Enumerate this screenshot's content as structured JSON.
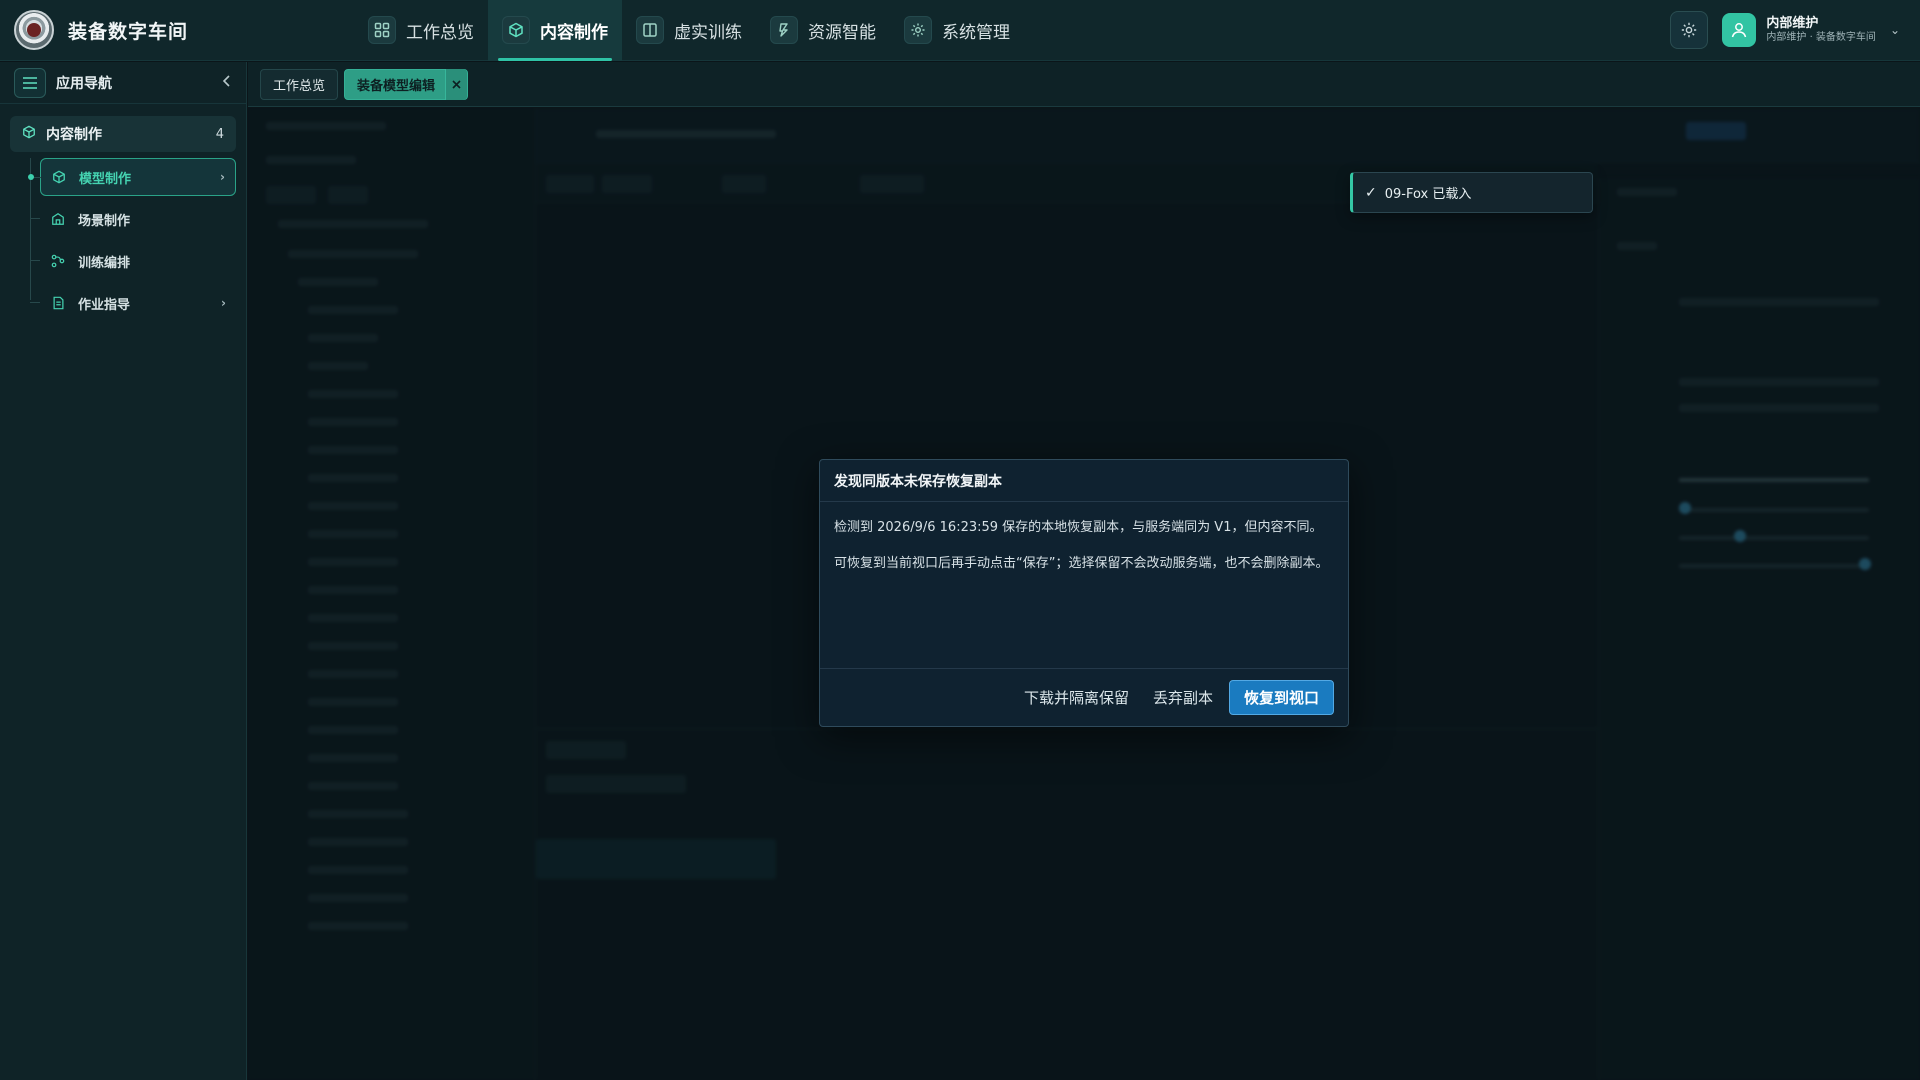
{
  "app": {
    "title": "装备数字车间"
  },
  "topnav": {
    "items": [
      {
        "label": "工作总览",
        "icon": "dashboard-grid-icon"
      },
      {
        "label": "内容制作",
        "icon": "cube-icon",
        "active": true
      },
      {
        "label": "虚实训练",
        "icon": "book-icon"
      },
      {
        "label": "资源智能",
        "icon": "lightning-icon"
      },
      {
        "label": "系统管理",
        "icon": "gear-icon"
      }
    ]
  },
  "user": {
    "name": "内部维护",
    "subtitle": "内部维护 · 装备数字车间"
  },
  "sidebar": {
    "title": "应用导航",
    "group": {
      "label": "内容制作",
      "count": "4"
    },
    "items": [
      {
        "label": "模型制作",
        "icon": "cube-icon",
        "active": true,
        "has_children": true
      },
      {
        "label": "场景制作",
        "icon": "building-icon"
      },
      {
        "label": "训练编排",
        "icon": "flow-icon"
      },
      {
        "label": "作业指导",
        "icon": "document-icon",
        "has_children": true
      }
    ]
  },
  "tabs": [
    {
      "label": "工作总览"
    },
    {
      "label": "装备模型编辑",
      "active": true,
      "closable": true
    }
  ],
  "toast": {
    "text": "09-Fox 已载入"
  },
  "dialog": {
    "title": "发现同版本未保存恢复副本",
    "paragraph1": "检测到 2026/9/6 16:23:59 保存的本地恢复副本，与服务端同为 V1，但内容不同。",
    "paragraph2": "可恢复到当前视口后再手动点击“保存”；选择保留不会改动服务端，也不会删除副本。",
    "buttons": {
      "download": "下载并隔离保留",
      "discard": "丢弃副本",
      "restore": "恢复到视口"
    }
  },
  "colors": {
    "accent": "#2fc3a6",
    "primary_button": "#1a7bc0",
    "topbar_bg": "#10272b",
    "sidebar_bg": "#0f2327"
  }
}
